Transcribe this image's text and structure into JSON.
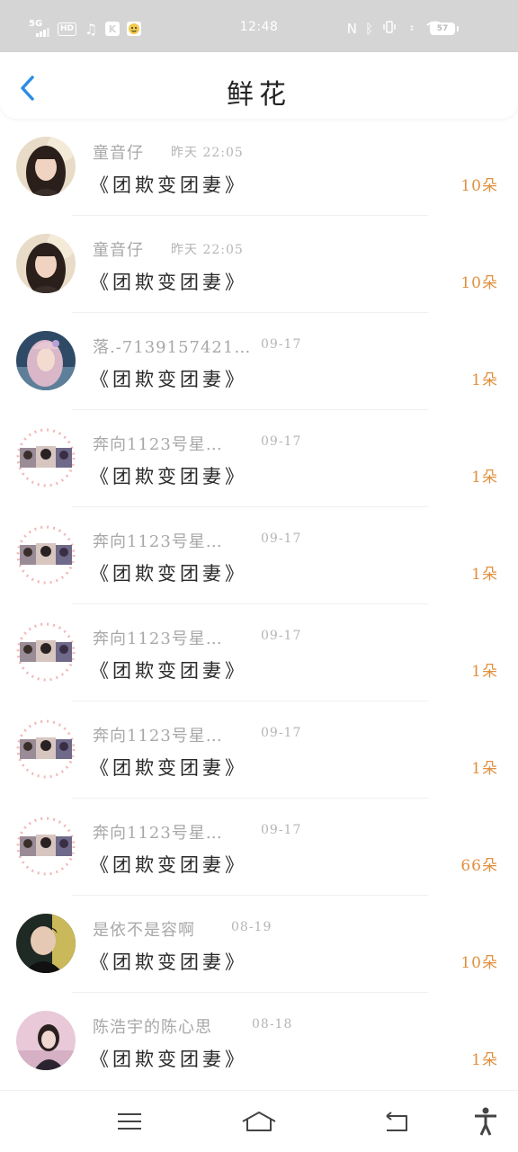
{
  "status_bar": {
    "network": "5G",
    "hd_badge": "HD",
    "time": "12:48",
    "battery": "57",
    "icons": [
      "music-icon",
      "k-app-icon",
      "face-app-icon",
      "nfc-icon",
      "bluetooth-icon",
      "vibrate-icon",
      "wifi-icon"
    ]
  },
  "header": {
    "title": "鲜花",
    "back_icon": "chevron-left-icon",
    "accent": "#2a8de6"
  },
  "rows": [
    {
      "name": "童音仔",
      "time": "昨天 22:05",
      "gift": "《团欺变团妻》",
      "count": "10朵",
      "avatar": "girl-avatar"
    },
    {
      "name": "童音仔",
      "time": "昨天 22:05",
      "gift": "《团欺变团妻》",
      "count": "10朵",
      "avatar": "girl-avatar"
    },
    {
      "name": "落.-7139157421…",
      "time": "09-17",
      "gift": "《团欺变团妻》",
      "count": "1朵",
      "avatar": "pink-hair-avatar"
    },
    {
      "name": "奔向1123号星…",
      "time": "09-17",
      "gift": "《团欺变团妻》",
      "count": "1朵",
      "avatar": "collage-avatar"
    },
    {
      "name": "奔向1123号星…",
      "time": "09-17",
      "gift": "《团欺变团妻》",
      "count": "1朵",
      "avatar": "collage-avatar"
    },
    {
      "name": "奔向1123号星…",
      "time": "09-17",
      "gift": "《团欺变团妻》",
      "count": "1朵",
      "avatar": "collage-avatar"
    },
    {
      "name": "奔向1123号星…",
      "time": "09-17",
      "gift": "《团欺变团妻》",
      "count": "1朵",
      "avatar": "collage-avatar"
    },
    {
      "name": "奔向1123号星…",
      "time": "09-17",
      "gift": "《团欺变团妻》",
      "count": "66朵",
      "avatar": "collage-avatar"
    },
    {
      "name": "是依不是容啊",
      "time": "08-19",
      "gift": "《团欺变团妻》",
      "count": "10朵",
      "avatar": "boy-avatar"
    },
    {
      "name": "陈浩宇的陈心思",
      "time": "08-18",
      "gift": "《团欺变团妻》",
      "count": "1朵",
      "avatar": "pink-photo-avatar"
    }
  ],
  "colors": {
    "name": "#a8a8a8",
    "time": "#b5b5b5",
    "gift": "#2a2a2a",
    "count": "#e0903e",
    "status_bar_bg": "#d5d5d5"
  },
  "nav_bar": {
    "icons": [
      "menu-icon",
      "home-icon",
      "back-icon",
      "accessibility-icon"
    ]
  }
}
